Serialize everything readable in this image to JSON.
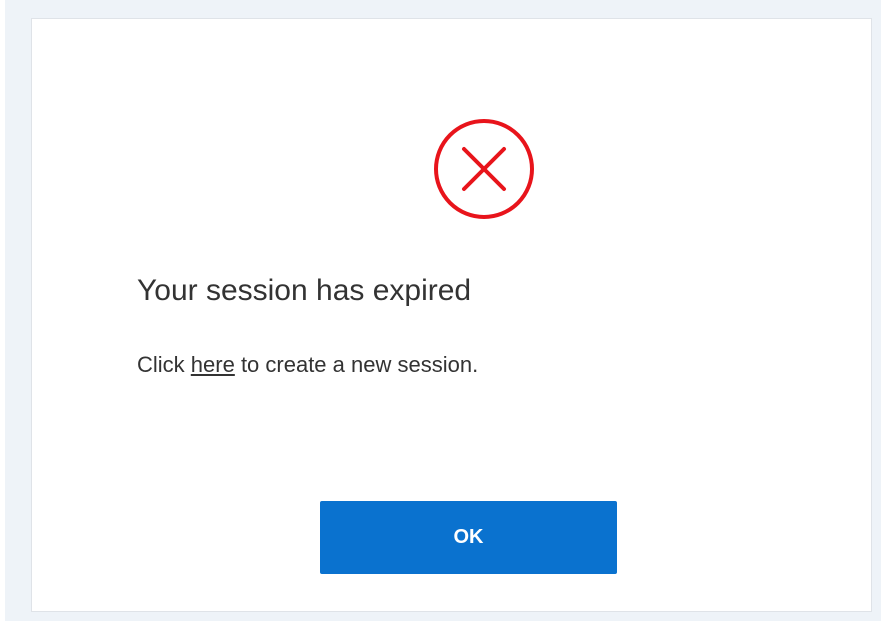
{
  "dialog": {
    "title": "Your session has expired",
    "message": {
      "prefix": "Click ",
      "link_text": "here",
      "suffix": " to create a new session."
    },
    "ok_label": "OK",
    "icon": "error-circle-x-icon"
  },
  "colors": {
    "icon_red": "#e8141b",
    "button_blue": "#0a72cf",
    "text": "#333333",
    "background": "#eef3f8"
  }
}
